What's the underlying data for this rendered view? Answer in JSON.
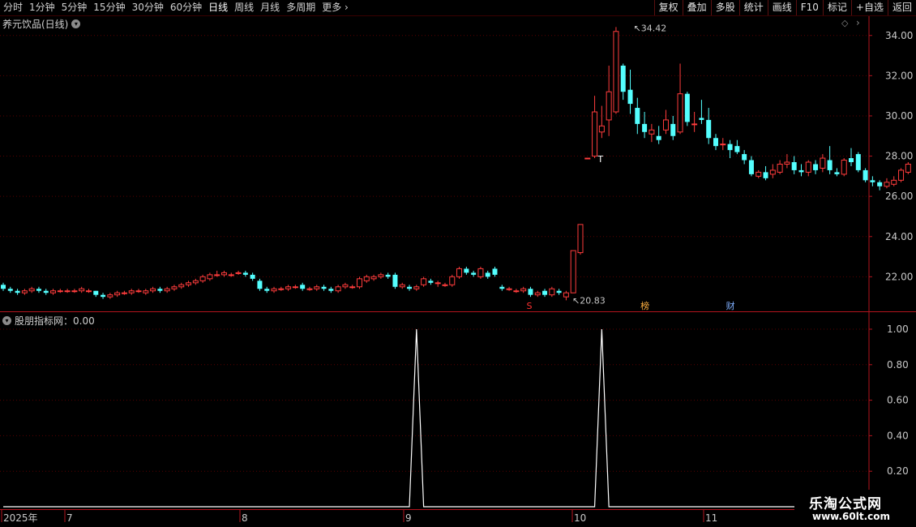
{
  "toolbar": {
    "periods": [
      "分时",
      "1分钟",
      "5分钟",
      "15分钟",
      "30分钟",
      "60分钟",
      "日线",
      "周线",
      "月线",
      "多周期"
    ],
    "active_period": "日线",
    "more": "更多",
    "buttons": [
      "复权",
      "叠加",
      "多股",
      "统计",
      "画线",
      "F10",
      "标记",
      "+自选",
      "返回"
    ]
  },
  "main_title": "养元饮品(日线)",
  "indicator_title": "股朋指标网：0.00",
  "watermark": {
    "title": "乐淘公式网",
    "url": "www.60lt.com"
  },
  "colors": {
    "up": "#ff3c3c",
    "down": "#54ffff",
    "grid": "#5a0000",
    "axis": "#b4141e",
    "text": "#c8c8c8"
  },
  "chart_data": [
    {
      "type": "candlestick",
      "title": "养元饮品(日线)",
      "y_ticks": [
        "22.00",
        "24.00",
        "26.00",
        "28.00",
        "30.00",
        "32.00",
        "34.00"
      ],
      "ylim": [
        20.2,
        35.2
      ],
      "grid": true,
      "x_ticks": [
        "2025年",
        "7",
        "8",
        "9",
        "10",
        "11"
      ],
      "max_label": "34.42",
      "min_label": "20.83",
      "markers": [
        {
          "text": "T",
          "index": 84,
          "color": "#ffffff"
        },
        {
          "text": "S",
          "index": 74,
          "color": "#ff3030"
        },
        {
          "text": "榜",
          "index": 90,
          "color": "#ffb040"
        },
        {
          "text": "财",
          "index": 102,
          "color": "#80b0ff"
        }
      ],
      "ohlc": [
        [
          21.6,
          21.4,
          21.7,
          21.3
        ],
        [
          21.4,
          21.3,
          21.5,
          21.2
        ],
        [
          21.3,
          21.2,
          21.4,
          21.1
        ],
        [
          21.2,
          21.3,
          21.4,
          21.1
        ],
        [
          21.3,
          21.4,
          21.5,
          21.2
        ],
        [
          21.4,
          21.3,
          21.5,
          21.2
        ],
        [
          21.3,
          21.2,
          21.4,
          21.1
        ],
        [
          21.2,
          21.3,
          21.4,
          21.1
        ],
        [
          21.3,
          21.3,
          21.4,
          21.2
        ],
        [
          21.3,
          21.3,
          21.4,
          21.2
        ],
        [
          21.3,
          21.3,
          21.4,
          21.2
        ],
        [
          21.3,
          21.4,
          21.5,
          21.2
        ],
        [
          21.3,
          21.3,
          21.4,
          21.2
        ],
        [
          21.3,
          21.1,
          21.3,
          21.0
        ],
        [
          21.1,
          21.0,
          21.2,
          20.9
        ],
        [
          21.0,
          21.1,
          21.2,
          20.9
        ],
        [
          21.1,
          21.2,
          21.3,
          21.0
        ],
        [
          21.2,
          21.2,
          21.3,
          21.1
        ],
        [
          21.2,
          21.3,
          21.4,
          21.1
        ],
        [
          21.3,
          21.3,
          21.4,
          21.2
        ],
        [
          21.2,
          21.3,
          21.4,
          21.1
        ],
        [
          21.3,
          21.4,
          21.5,
          21.2
        ],
        [
          21.4,
          21.3,
          21.5,
          21.2
        ],
        [
          21.3,
          21.4,
          21.5,
          21.2
        ],
        [
          21.4,
          21.5,
          21.6,
          21.3
        ],
        [
          21.5,
          21.6,
          21.7,
          21.4
        ],
        [
          21.6,
          21.7,
          21.8,
          21.5
        ],
        [
          21.7,
          21.8,
          21.9,
          21.6
        ],
        [
          21.8,
          22.0,
          22.1,
          21.7
        ],
        [
          21.9,
          22.1,
          22.2,
          21.8
        ],
        [
          22.1,
          22.1,
          22.3,
          22.0
        ],
        [
          22.1,
          22.2,
          22.3,
          22.0
        ],
        [
          22.1,
          22.1,
          22.2,
          22.0
        ],
        [
          22.2,
          22.2,
          22.3,
          22.1
        ],
        [
          22.2,
          22.1,
          22.3,
          22.0
        ],
        [
          22.1,
          21.9,
          22.2,
          21.8
        ],
        [
          21.8,
          21.4,
          21.9,
          21.3
        ],
        [
          21.4,
          21.3,
          21.5,
          21.2
        ],
        [
          21.3,
          21.4,
          21.5,
          21.2
        ],
        [
          21.4,
          21.4,
          21.5,
          21.3
        ],
        [
          21.4,
          21.5,
          21.6,
          21.3
        ],
        [
          21.5,
          21.5,
          21.6,
          21.4
        ],
        [
          21.6,
          21.4,
          21.7,
          21.3
        ],
        [
          21.4,
          21.4,
          21.5,
          21.3
        ],
        [
          21.4,
          21.5,
          21.6,
          21.3
        ],
        [
          21.5,
          21.4,
          21.6,
          21.3
        ],
        [
          21.4,
          21.3,
          21.5,
          21.2
        ],
        [
          21.3,
          21.5,
          21.6,
          21.2
        ],
        [
          21.5,
          21.6,
          21.7,
          21.4
        ],
        [
          21.5,
          21.5,
          21.6,
          21.4
        ],
        [
          21.5,
          21.9,
          22.0,
          21.4
        ],
        [
          21.8,
          22.0,
          22.1,
          21.7
        ],
        [
          21.9,
          22.0,
          22.1,
          21.8
        ],
        [
          22.0,
          22.1,
          22.2,
          21.9
        ],
        [
          22.1,
          22.0,
          22.2,
          21.9
        ],
        [
          22.1,
          21.5,
          22.2,
          21.4
        ],
        [
          21.5,
          21.6,
          21.7,
          21.4
        ],
        [
          21.5,
          21.4,
          21.6,
          21.3
        ],
        [
          21.4,
          21.5,
          21.6,
          21.3
        ],
        [
          21.6,
          21.9,
          22.0,
          21.5
        ],
        [
          21.8,
          21.7,
          21.9,
          21.6
        ],
        [
          21.7,
          21.7,
          21.8,
          21.5
        ],
        [
          21.6,
          21.6,
          21.7,
          21.5
        ],
        [
          21.6,
          22.0,
          22.1,
          21.5
        ],
        [
          22.0,
          22.4,
          22.5,
          21.9
        ],
        [
          22.4,
          22.2,
          22.5,
          22.1
        ],
        [
          22.2,
          22.1,
          22.3,
          22.0
        ],
        [
          22.0,
          22.4,
          22.5,
          21.9
        ],
        [
          22.2,
          22.0,
          22.3,
          21.9
        ],
        [
          22.4,
          22.1,
          22.5,
          22.0
        ],
        [
          21.5,
          21.4,
          21.6,
          21.3
        ],
        [
          21.4,
          21.4,
          21.5,
          21.3
        ],
        [
          21.3,
          21.3,
          21.4,
          21.2
        ],
        [
          21.3,
          21.4,
          21.5,
          21.2
        ],
        [
          21.4,
          21.1,
          21.5,
          21.0
        ],
        [
          21.1,
          21.2,
          21.3,
          21.0
        ],
        [
          21.3,
          21.1,
          21.4,
          21.0
        ],
        [
          21.1,
          21.4,
          21.5,
          21.0
        ],
        [
          21.3,
          21.2,
          21.4,
          21.1
        ],
        [
          21.0,
          21.2,
          21.3,
          20.83
        ],
        [
          21.2,
          23.3,
          23.3,
          21.2
        ],
        [
          23.2,
          24.6,
          24.6,
          23.1
        ],
        [
          27.9,
          27.9,
          27.9,
          27.9
        ],
        [
          28.0,
          30.2,
          31.0,
          27.9
        ],
        [
          29.2,
          29.5,
          30.5,
          28.9
        ],
        [
          29.8,
          31.2,
          32.5,
          29.0
        ],
        [
          30.2,
          34.2,
          34.42,
          30.1
        ],
        [
          32.5,
          31.2,
          32.6,
          30.8
        ],
        [
          31.3,
          30.6,
          32.3,
          30.1
        ],
        [
          30.4,
          29.6,
          30.9,
          29.1
        ],
        [
          29.6,
          29.2,
          30.2,
          28.9
        ],
        [
          29.1,
          29.3,
          29.6,
          28.7
        ],
        [
          29.0,
          28.8,
          29.5,
          28.6
        ],
        [
          29.3,
          29.8,
          30.3,
          29.1
        ],
        [
          29.6,
          29.0,
          30.0,
          28.8
        ],
        [
          29.2,
          31.1,
          32.6,
          29.1
        ],
        [
          31.1,
          29.7,
          31.2,
          29.5
        ],
        [
          29.6,
          29.6,
          30.2,
          29.2
        ],
        [
          29.9,
          29.8,
          30.8,
          29.6
        ],
        [
          29.8,
          28.9,
          30.4,
          28.6
        ],
        [
          28.9,
          28.5,
          29.1,
          28.3
        ],
        [
          28.6,
          28.6,
          28.9,
          28.3
        ],
        [
          28.6,
          28.3,
          28.8,
          27.9
        ],
        [
          28.5,
          28.2,
          28.8,
          28.1
        ],
        [
          28.1,
          27.8,
          28.3,
          27.6
        ],
        [
          27.8,
          27.1,
          28.0,
          27.0
        ],
        [
          27.0,
          27.2,
          27.3,
          26.9
        ],
        [
          27.2,
          26.9,
          27.5,
          26.8
        ],
        [
          27.1,
          27.3,
          27.6,
          26.9
        ],
        [
          27.2,
          27.6,
          27.8,
          27.1
        ],
        [
          27.6,
          27.7,
          28.1,
          27.4
        ],
        [
          27.7,
          27.3,
          28.0,
          27.1
        ],
        [
          27.3,
          27.2,
          27.6,
          27.0
        ],
        [
          27.2,
          27.7,
          27.8,
          27.0
        ],
        [
          27.6,
          27.3,
          27.8,
          27.1
        ],
        [
          27.4,
          27.9,
          28.1,
          27.2
        ],
        [
          27.8,
          27.3,
          28.5,
          27.1
        ],
        [
          27.2,
          27.1,
          27.4,
          27.0
        ],
        [
          27.1,
          27.8,
          27.9,
          27.0
        ],
        [
          27.9,
          27.7,
          28.4,
          27.5
        ],
        [
          28.1,
          27.3,
          28.2,
          27.2
        ],
        [
          27.3,
          26.8,
          27.4,
          26.7
        ],
        [
          26.8,
          26.7,
          27.0,
          26.5
        ],
        [
          26.7,
          26.5,
          26.8,
          26.3
        ],
        [
          26.5,
          26.7,
          26.9,
          26.4
        ],
        [
          26.6,
          26.8,
          27.0,
          26.5
        ],
        [
          26.8,
          27.3,
          27.4,
          26.7
        ],
        [
          27.2,
          27.6,
          27.7,
          27.1
        ]
      ]
    },
    {
      "type": "line",
      "title": "股朋指标网",
      "value_shown": "0.00",
      "y_ticks": [
        "0.20",
        "0.40",
        "0.60",
        "0.80",
        "1.00"
      ],
      "ylim": [
        0,
        1.0
      ],
      "spikes_at_index": [
        58,
        84
      ],
      "values": "0 everywhere except 1.00 at spike indices"
    }
  ]
}
